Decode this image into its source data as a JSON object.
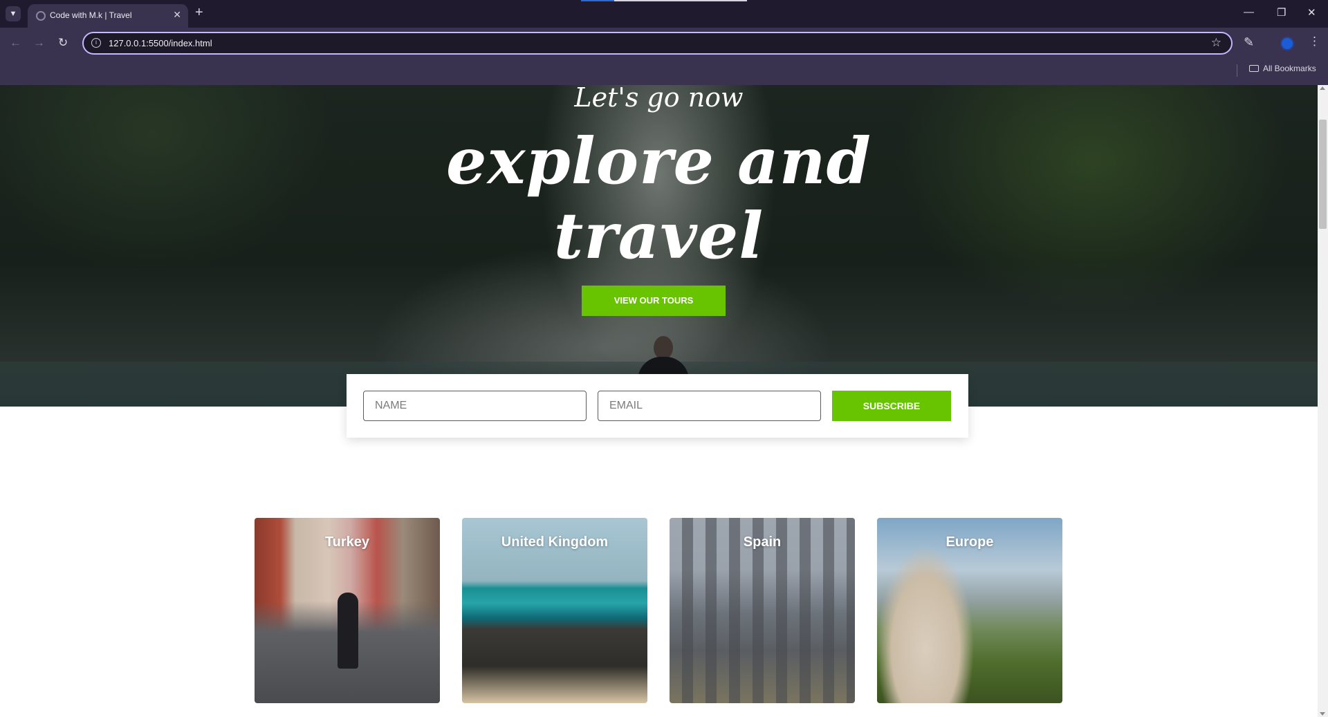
{
  "browser": {
    "tab_title": "Code with M.k | Travel",
    "url": "127.0.0.1:5500/index.html",
    "bookmarks_label": "All Bookmarks",
    "icons": {
      "tab_list": "chevron-down-icon",
      "tab_favicon": "globe-icon",
      "tab_close": "close-icon",
      "new_tab": "plus-icon",
      "back": "arrow-left-icon",
      "forward": "arrow-right-icon",
      "reload": "reload-icon",
      "site_info": "info-icon",
      "bookmark_star": "star-icon",
      "extensions": "puzzle-icon",
      "menu": "kebab-icon",
      "bookmarks_folder": "folder-icon"
    }
  },
  "hero": {
    "subtitle": "Let's go now",
    "title_line1": "explore and",
    "title_line2": "travel",
    "cta_label": "VIEW OUR TOURS"
  },
  "subscribe": {
    "name_placeholder": "NAME",
    "email_placeholder": "EMAIL",
    "button_label": "SUBSCRIBE"
  },
  "destinations": [
    {
      "label": "Turkey"
    },
    {
      "label": "United Kingdom"
    },
    {
      "label": "Spain"
    },
    {
      "label": "Europe"
    }
  ],
  "colors": {
    "accent_green": "#69c400",
    "chrome_dark": "#1f1a2e",
    "chrome_toolbar": "#3a3350",
    "omnibox_focus": "#c6b8ff"
  }
}
